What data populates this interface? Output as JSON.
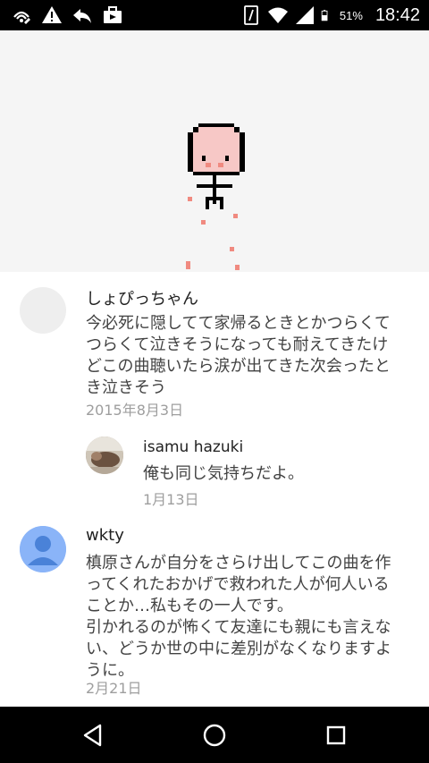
{
  "status_bar": {
    "icons_left": [
      "wifi-calling-icon",
      "warning-icon",
      "reply-icon",
      "bag-icon"
    ],
    "icons_right": [
      "nfc-card-icon",
      "wifi-icon",
      "cell-signal-icon",
      "battery-icon"
    ],
    "battery_percent": "51%",
    "time": "18:42"
  },
  "artwork": {
    "description_icon": "pixel-character-icon",
    "background": "#f5f5f5",
    "face_color": "#f7c8c6",
    "accent_color": "#f08a80"
  },
  "comments": [
    {
      "author": "しょぴっちゃん",
      "avatar": "blank-avatar",
      "lines": [
        "今必死に隠してて家帰るときとかつらくて",
        "つらくて泣きそうになっても耐えてきたけ",
        "どこの曲聴いたら涙が出てきた次会ったと",
        "き泣きそう"
      ],
      "date": "2015年8月3日"
    },
    {
      "author": "isamu hazuki",
      "avatar": "photo-avatar",
      "lines": [
        "俺も同じ気持ちだよ。"
      ],
      "date": "1月13日",
      "reply": true
    },
    {
      "author": "wkty",
      "avatar": "default-user-avatar",
      "lines": [
        "槙原さんが自分をさらけ出してこの曲を作",
        "ってくれたおかげで救われた人が何人いる",
        "ことか…私もその一人です。",
        "引かれるのが怖くて友達にも親にも言えな",
        "い、どうか世の中に差別がなくなりますよ",
        "うに。"
      ],
      "date": "2月21日"
    }
  ],
  "navigation": {
    "back": "back-triangle-icon",
    "home": "home-circle-icon",
    "recents": "recents-square-icon"
  }
}
